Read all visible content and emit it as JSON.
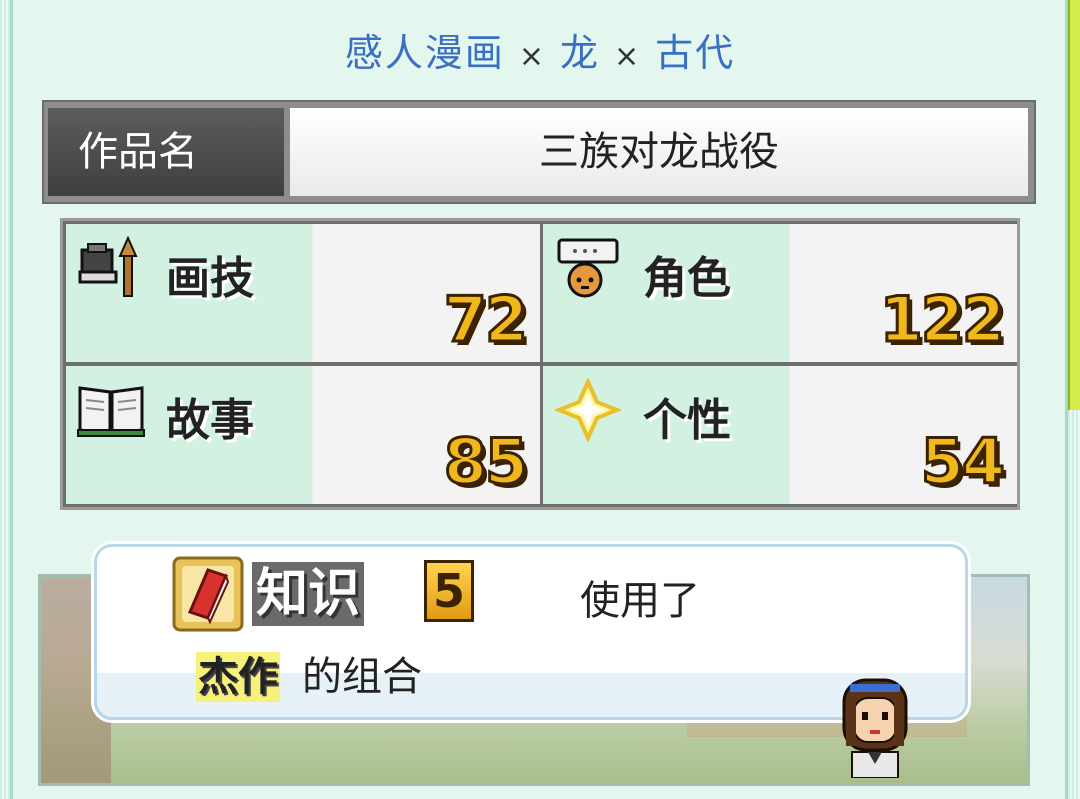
{
  "genre": {
    "part1": "感人漫画",
    "sep1": "×",
    "part2": "龙",
    "sep2": "×",
    "part3": "古代"
  },
  "work": {
    "label": "作品名",
    "title": "三族对龙战役"
  },
  "stats": [
    {
      "label": "画技",
      "value": "72",
      "icon": "paint-brush-icon"
    },
    {
      "label": "角色",
      "value": "122",
      "icon": "character-speech-icon"
    },
    {
      "label": "故事",
      "value": "85",
      "icon": "open-book-icon"
    },
    {
      "label": "个性",
      "value": "54",
      "icon": "sparkle-icon"
    }
  ],
  "dialogue": {
    "knowledge_label": "知识",
    "knowledge_value": "5",
    "used_text": "使用了",
    "highlight": "杰作",
    "combo_text": "的组合"
  },
  "colors": {
    "genre": "#3a6fc4",
    "value_gold": "#f0b81a",
    "cell_green": "#d2f1e1"
  }
}
